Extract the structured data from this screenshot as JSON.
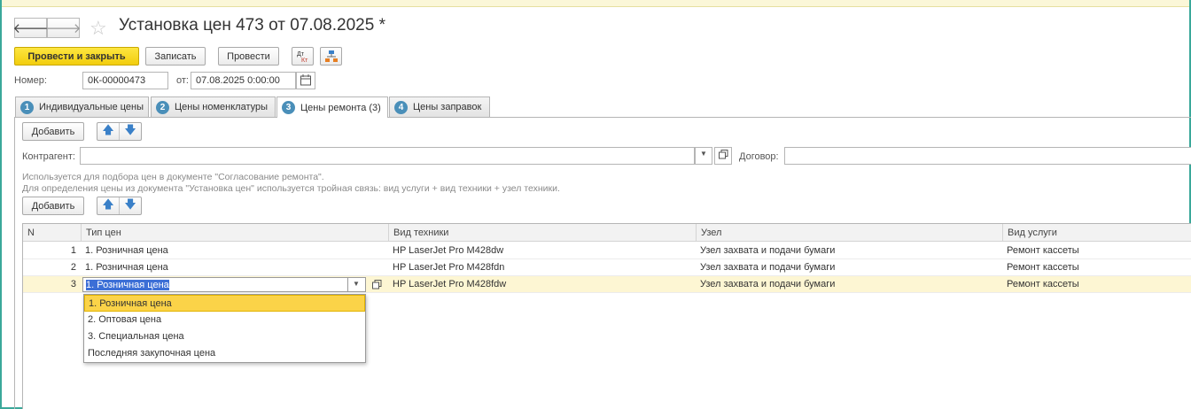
{
  "window": {
    "title": "Установка цен 473 от 07.08.2025 *"
  },
  "nav": {
    "back_icon": "arrow-left-icon",
    "forward_icon": "arrow-right-icon",
    "star_icon": "star-icon"
  },
  "toolbar": {
    "post_close_label": "Провести и закрыть",
    "save_label": "Записать",
    "post_label": "Провести",
    "dt_kt_icon": "Дт Кт",
    "structure_icon": "structure-icon"
  },
  "header": {
    "number_label": "Номер:",
    "number_value": "0К-00000473",
    "date_label": "от:",
    "date_value": "07.08.2025  0:00:00",
    "calendar_icon": "calendar-icon"
  },
  "tabs": [
    {
      "num": "1",
      "label": "Индивидуальные цены"
    },
    {
      "num": "2",
      "label": "Цены номенклатуры"
    },
    {
      "num": "3",
      "label": "Цены ремонта (3)"
    },
    {
      "num": "4",
      "label": "Цены заправок"
    }
  ],
  "panel": {
    "add_label": "Добавить",
    "up_icon": "arrow-up-icon",
    "down_icon": "arrow-down-icon",
    "counterparty_label": "Контрагент:",
    "counterparty_value": "",
    "contract_label": "Договор:",
    "contract_value": "",
    "note_line1": "Используется для подбора цен в документе \"Согласование ремонта\".",
    "note_line2": "Для определения цены из документа \"Установка цен\" используется тройная связь: вид услуги + вид техники + узел техники.",
    "add2_label": "Добавить"
  },
  "grid": {
    "columns": [
      "N",
      "Тип цен",
      "Вид техники",
      "Узел",
      "Вид услуги"
    ],
    "rows": [
      {
        "n": "1",
        "price_type": "1. Розничная цена",
        "equipment": "HP LaserJet Pro M428dw",
        "node": "Узел захвата и подачи бумаги",
        "service": "Ремонт кассеты"
      },
      {
        "n": "2",
        "price_type": "1. Розничная цена",
        "equipment": "HP LaserJet Pro M428fdn",
        "node": "Узел захвата и подачи бумаги",
        "service": "Ремонт кассеты"
      },
      {
        "n": "3",
        "price_type": "1. Розничная цена",
        "equipment": "HP LaserJet Pro M428fdw",
        "node": "Узел захвата и подачи бумаги",
        "service": "Ремонт кассеты"
      }
    ]
  },
  "dropdown": {
    "options": [
      "1. Розничная цена",
      "2. Оптовая цена",
      "3. Специальная цена",
      "Последняя закупочная цена"
    ],
    "selected": "1. Розничная цена"
  },
  "colors": {
    "accent_yellow": "#f2cd0d",
    "frame_teal": "#3aa89a",
    "tab_number_blue": "#4a8fb9",
    "selected_row": "#fdf6d3"
  }
}
